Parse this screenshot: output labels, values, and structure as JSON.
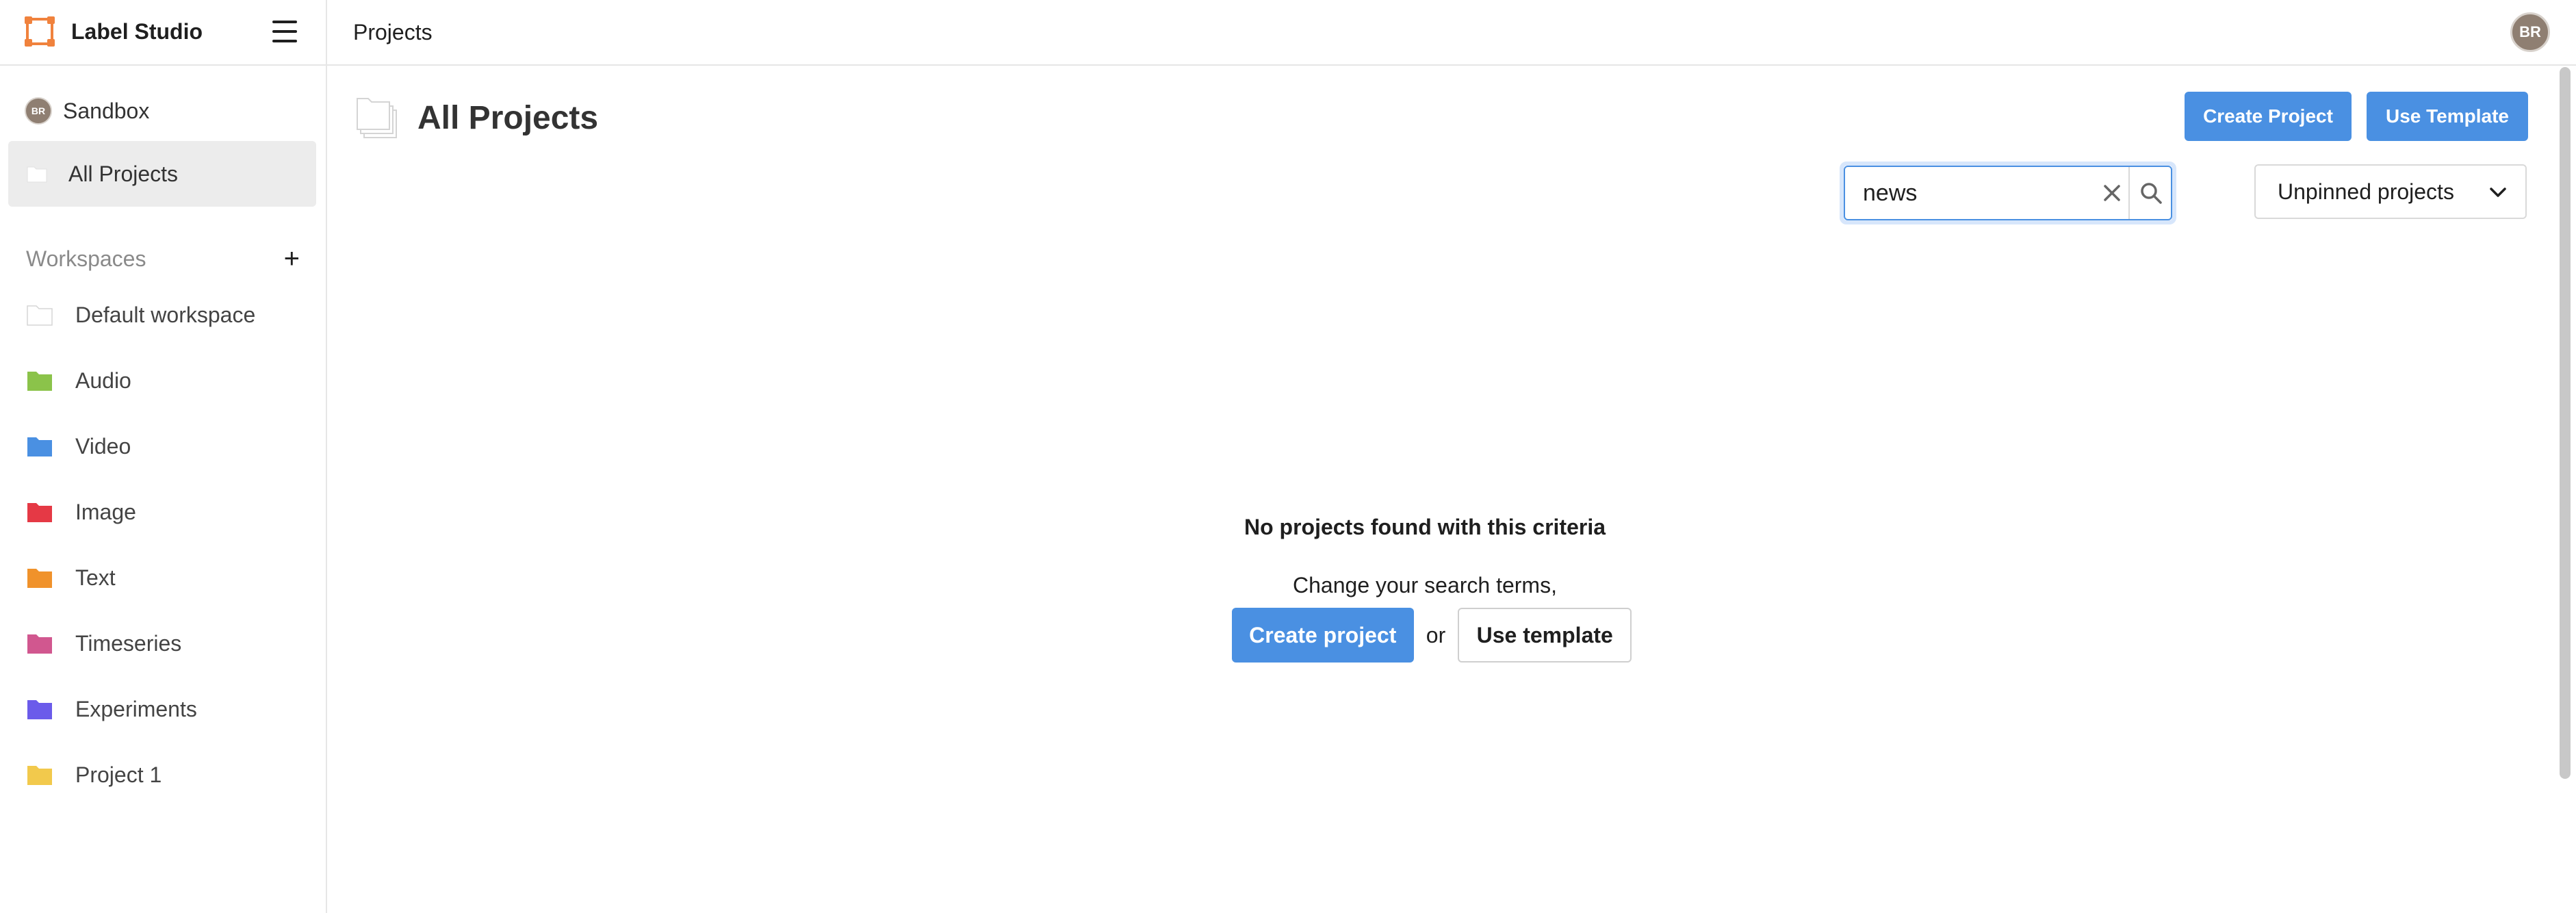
{
  "app": {
    "name": "Label Studio",
    "breadcrumb": "Projects",
    "user_initials": "BR"
  },
  "sidebar": {
    "sandbox": {
      "label": "Sandbox",
      "avatar": "BR"
    },
    "all_projects": {
      "label": "All Projects"
    },
    "workspaces_header": "Workspaces",
    "add_label": "+",
    "workspaces": [
      {
        "label": "Default workspace",
        "color": "#ffffff"
      },
      {
        "label": "Audio",
        "color": "#8bc34a"
      },
      {
        "label": "Video",
        "color": "#4a90e2"
      },
      {
        "label": "Image",
        "color": "#e53945"
      },
      {
        "label": "Text",
        "color": "#f0922b"
      },
      {
        "label": "Timeseries",
        "color": "#d1578f"
      },
      {
        "label": "Experiments",
        "color": "#6b5bea"
      },
      {
        "label": "Project 1",
        "color": "#f2c94c"
      }
    ]
  },
  "main": {
    "title": "All Projects",
    "create_button": "Create Project",
    "template_button": "Use Template",
    "search": {
      "value": "news",
      "placeholder": ""
    },
    "filter": {
      "selected": "Unpinned projects"
    },
    "empty_state": {
      "title": "No projects found with this criteria",
      "hint": "Change your search terms,",
      "create_label": "Create project",
      "or_label": "or",
      "template_label": "Use template"
    }
  },
  "colors": {
    "accent": "#4a90e2",
    "logo": "#f0823d"
  }
}
